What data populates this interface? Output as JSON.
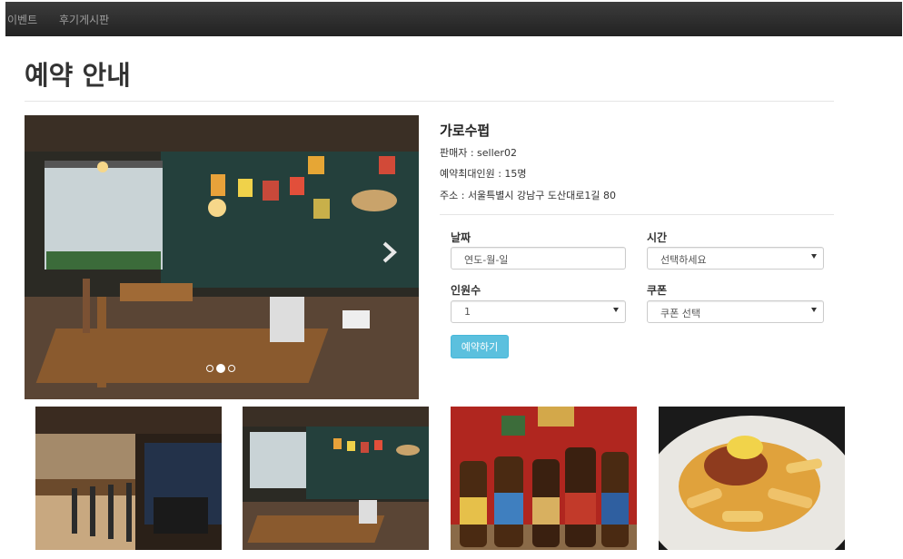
{
  "nav": {
    "items": [
      "이벤트",
      "후기게시판"
    ]
  },
  "page": {
    "title": "예약 안내"
  },
  "shop": {
    "name": "가로수펍",
    "seller": "판매자 : seller02",
    "max_people": "예약최대인원 : 15명",
    "address": "주소 : 서울특별시 강남구 도산대로1길 80"
  },
  "form": {
    "date_label": "날짜",
    "date_placeholder": "연도-월-일",
    "time_label": "시간",
    "time_value": "선택하세요",
    "people_label": "인원수",
    "people_value": "1",
    "coupon_label": "쿠폰",
    "coupon_value": "쿠폰 선택",
    "submit_label": "예약하기"
  },
  "carousel": {
    "slide_count": 3,
    "active_index": 1,
    "next_icon": "chevron-right-icon"
  },
  "thumbnails": [
    {
      "name": "bar-counter-photo"
    },
    {
      "name": "pub-interior-photo"
    },
    {
      "name": "beer-bottles-photo"
    },
    {
      "name": "chili-fries-photo"
    }
  ]
}
